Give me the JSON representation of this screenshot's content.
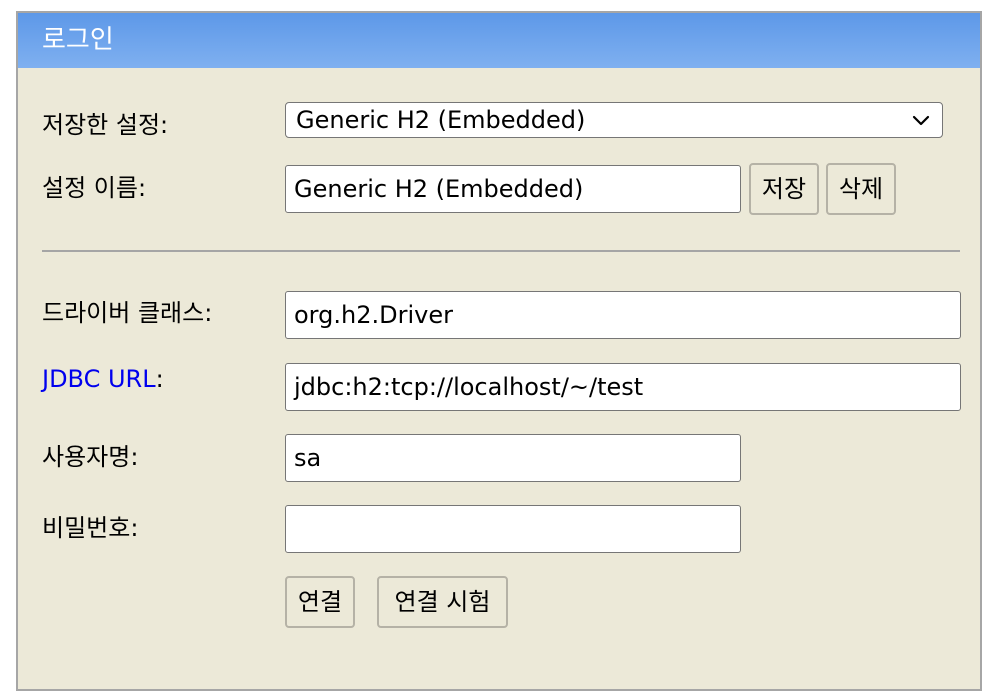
{
  "window": {
    "title": "로그인"
  },
  "form": {
    "saved_settings_label": "저장한 설정:",
    "saved_settings_value": "Generic H2 (Embedded)",
    "setting_name_label": "설정 이름:",
    "setting_name_value": "Generic H2 (Embedded)",
    "save_button": "저장",
    "delete_button": "삭제",
    "driver_class_label": "드라이버 클래스:",
    "driver_class_value": "org.h2.Driver",
    "jdbc_url_link": "JDBC URL",
    "jdbc_url_colon": ":",
    "jdbc_url_value": "jdbc:h2:tcp://localhost/~/test",
    "username_label": "사용자명:",
    "username_value": "sa",
    "password_label": "비밀번호:",
    "password_value": "",
    "connect_button": "연결",
    "test_connection_button": "연결 시험"
  },
  "icons": {
    "select_arrow": "chevron-down-icon"
  },
  "colors": {
    "title_bar": "#6ea4ec",
    "panel_bg": "#ece9d8",
    "link": "#0000ee"
  }
}
